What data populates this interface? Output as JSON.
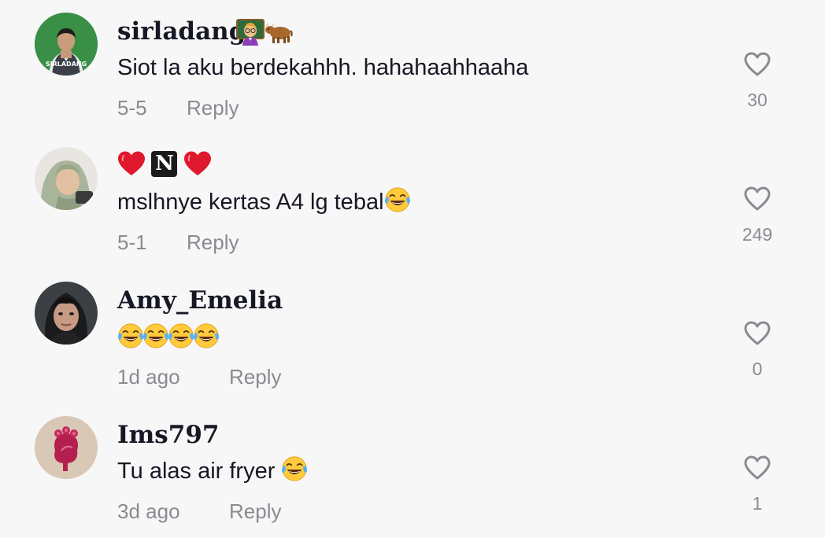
{
  "comments": [
    {
      "username": "sirladang",
      "badge_icons": [
        "teacher-emoji",
        "ox-emoji"
      ],
      "text": "Siot la aku berdekahhh. hahahaahhaaha",
      "date": "5-5",
      "reply_label": "Reply",
      "like_count": "30",
      "avatar_label": "SIRLADANG"
    },
    {
      "username_display": "red-heart + N + red-heart",
      "username_letter": "N",
      "text": "mslhnye kertas A4 lg tebal",
      "text_emoji": "face-with-tears-of-joy",
      "date": "5-1",
      "reply_label": "Reply",
      "like_count": "249"
    },
    {
      "username": "Amy_Emelia",
      "text_emojis": [
        "face-with-tears-of-joy",
        "face-with-tears-of-joy",
        "face-with-tears-of-joy",
        "face-with-tears-of-joy"
      ],
      "date": "1d ago",
      "reply_label": "Reply",
      "like_count": "0"
    },
    {
      "username": "Ims797",
      "text": "Tu alas air fryer ",
      "text_emoji": "face-with-tears-of-joy",
      "date": "3d ago",
      "reply_label": "Reply",
      "like_count": "1"
    }
  ],
  "colors": {
    "background": "#f7f7f8",
    "primary_text": "#161823",
    "secondary_text": "#8a8b91",
    "heart_outline": "#8a8b91",
    "red_heart": "#e0182d"
  }
}
